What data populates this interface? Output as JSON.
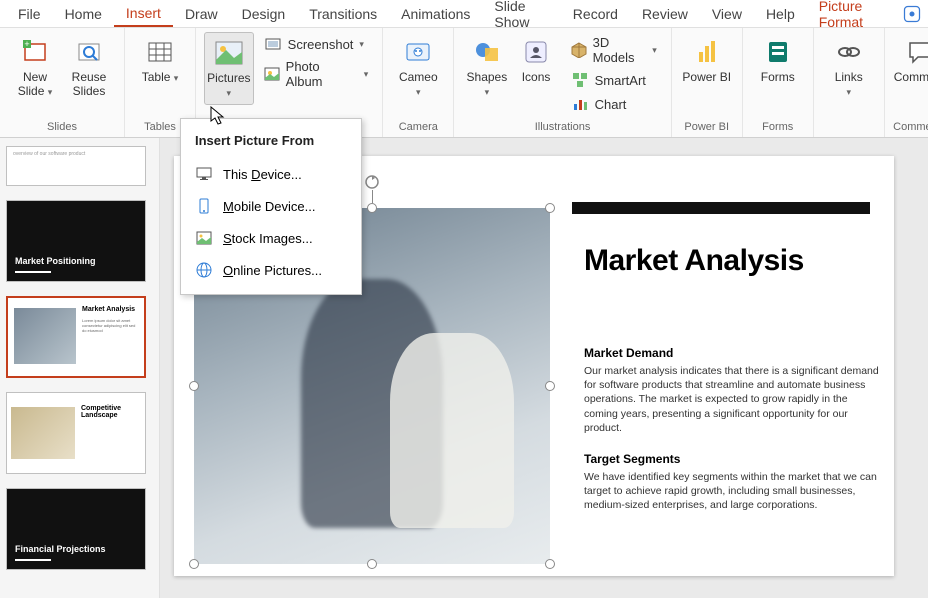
{
  "menu": {
    "tabs": [
      "File",
      "Home",
      "Insert",
      "Draw",
      "Design",
      "Transitions",
      "Animations",
      "Slide Show",
      "Record",
      "Review",
      "View",
      "Help",
      "Picture Format"
    ],
    "active": "Insert",
    "context": "Picture Format"
  },
  "ribbon": {
    "groups": {
      "slides": {
        "label": "Slides",
        "newSlide": "New Slide",
        "reuseSlides": "Reuse Slides"
      },
      "tables": {
        "label": "Tables",
        "table": "Table"
      },
      "images": {
        "pictures": "Pictures",
        "screenshot": "Screenshot",
        "photoAlbum": "Photo Album"
      },
      "camera": {
        "label": "Camera",
        "cameo": "Cameo"
      },
      "illustrations": {
        "label": "Illustrations",
        "shapes": "Shapes",
        "icons": "Icons",
        "models3d": "3D Models",
        "smartart": "SmartArt",
        "chart": "Chart"
      },
      "powerbi": {
        "label": "Power BI",
        "btn": "Power BI"
      },
      "forms": {
        "label": "Forms",
        "btn": "Forms"
      },
      "links": {
        "label": "",
        "btn": "Links"
      },
      "comments": {
        "label": "Comments",
        "btn": "Comment"
      }
    }
  },
  "dropdown": {
    "header": "Insert Picture From",
    "items": [
      {
        "label": "This Device...",
        "u": "D"
      },
      {
        "label": "Mobile Device...",
        "u": "M"
      },
      {
        "label": "Stock Images...",
        "u": "S"
      },
      {
        "label": "Online Pictures...",
        "u": "O"
      }
    ]
  },
  "thumbs": [
    {
      "kind": "stub",
      "title": "overview of our software product"
    },
    {
      "kind": "dark",
      "title": "Market Positioning"
    },
    {
      "kind": "light",
      "title": "Market Analysis",
      "selected": true
    },
    {
      "kind": "comp",
      "title": "Competitive Landscape"
    },
    {
      "kind": "dark",
      "title": "Financial Projections"
    }
  ],
  "slide": {
    "title": "Market Analysis",
    "sections": [
      {
        "heading": "Market Demand",
        "body": "Our market analysis indicates that there is a significant demand for software products that streamline and automate business operations. The market is expected to grow rapidly in the coming years, presenting a significant opportunity for our product."
      },
      {
        "heading": "Target Segments",
        "body": "We have identified key segments within the market that we can target to achieve rapid growth, including small businesses, medium-sized enterprises, and large corporations."
      }
    ]
  }
}
